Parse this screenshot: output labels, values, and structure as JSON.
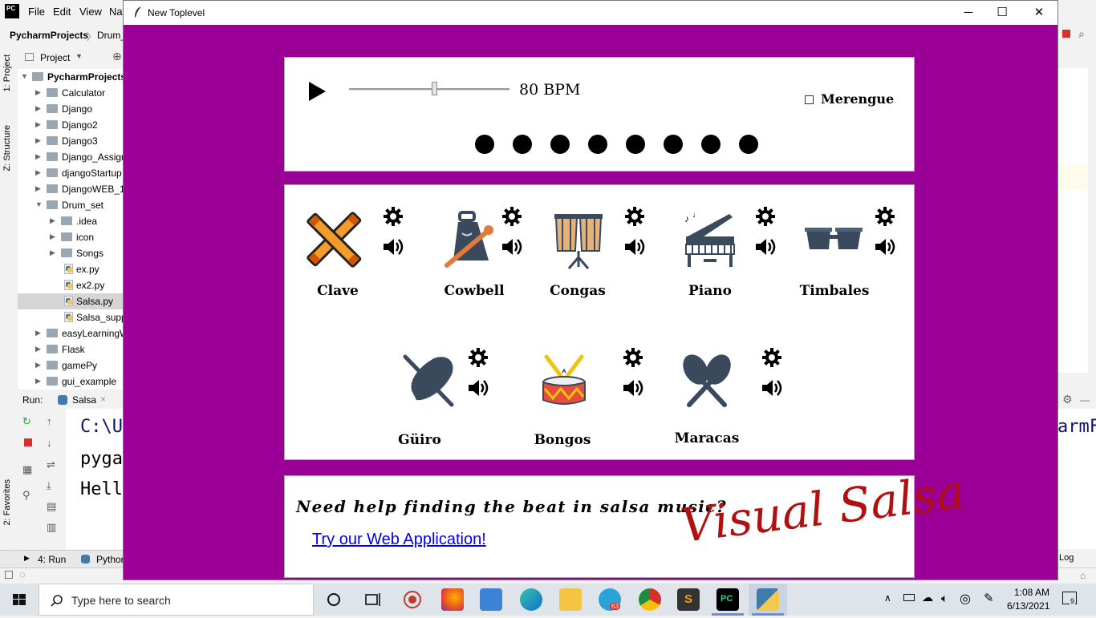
{
  "ide": {
    "menu": [
      "File",
      "Edit",
      "View",
      "Nav"
    ],
    "breadcrumb": [
      "PycharmProjects",
      "Drum_"
    ],
    "side_tabs": [
      "1: Project",
      "Z: Structure",
      "2: Favorites"
    ],
    "project_panel_title": "Project",
    "tree": [
      {
        "label": "PycharmProjects",
        "depth": 0,
        "expanded": true
      },
      {
        "label": "Calculator",
        "depth": 1
      },
      {
        "label": "Django",
        "depth": 1
      },
      {
        "label": "Django2",
        "depth": 1
      },
      {
        "label": "Django3",
        "depth": 1
      },
      {
        "label": "Django_Assign",
        "depth": 1
      },
      {
        "label": "djangoStartup",
        "depth": 1
      },
      {
        "label": "DjangoWEB_1",
        "depth": 1
      },
      {
        "label": "Drum_set",
        "depth": 1,
        "expanded": true
      },
      {
        "label": ".idea",
        "depth": 2
      },
      {
        "label": "icon",
        "depth": 2
      },
      {
        "label": "Songs",
        "depth": 2
      },
      {
        "label": "ex.py",
        "depth": 2,
        "file": true
      },
      {
        "label": "ex2.py",
        "depth": 2,
        "file": true
      },
      {
        "label": "Salsa.py",
        "depth": 2,
        "file": true,
        "selected": true
      },
      {
        "label": "Salsa_supp",
        "depth": 2,
        "file": true
      },
      {
        "label": "easyLearningW",
        "depth": 1
      },
      {
        "label": "Flask",
        "depth": 1
      },
      {
        "label": "gamePy",
        "depth": 1
      },
      {
        "label": "gui_example",
        "depth": 1
      }
    ],
    "run_label": "Run:",
    "run_config": "Salsa",
    "console_lines": [
      "C:\\U",
      "pyga",
      "Hell"
    ],
    "bottom_tabs": [
      "4: Run",
      "Pythor"
    ],
    "right_fragments": {
      "console": "armF",
      "tab": "Log"
    }
  },
  "window": {
    "title": "New Toplevel",
    "controls": [
      "minimize",
      "maximize",
      "close"
    ]
  },
  "controls": {
    "tempo": {
      "value": 80,
      "unit": "BPM",
      "min": 0,
      "max": 300
    },
    "bpm_text": "80  BPM",
    "merengue_label": "Merengue",
    "merengue_checked": false,
    "beat_count": 8
  },
  "instruments": [
    {
      "name": "Clave",
      "icon": "clave-icon"
    },
    {
      "name": "Cowbell",
      "icon": "cowbell-icon"
    },
    {
      "name": "Congas",
      "icon": "congas-icon"
    },
    {
      "name": "Piano",
      "icon": "piano-icon"
    },
    {
      "name": "Timbales",
      "icon": "timbales-icon"
    },
    {
      "name": "Güiro",
      "icon": "guiro-icon"
    },
    {
      "name": "Bongos",
      "icon": "bongos-icon"
    },
    {
      "name": "Maracas",
      "icon": "maracas-icon"
    }
  ],
  "ad": {
    "question": "Need help finding the beat in salsa music?",
    "link": "Try our Web Application!",
    "logo": "Visual Salsa"
  },
  "taskbar": {
    "search_placeholder": "Type here to search",
    "time": "1:08 AM",
    "date": "6/13/2021",
    "notification_count": "9",
    "telegram_badge": "63"
  },
  "colors": {
    "window_bg": "#9b0096",
    "instrument_dark": "#3a4a5c",
    "logo_red": "#b01010",
    "link_blue": "#0000ee"
  }
}
